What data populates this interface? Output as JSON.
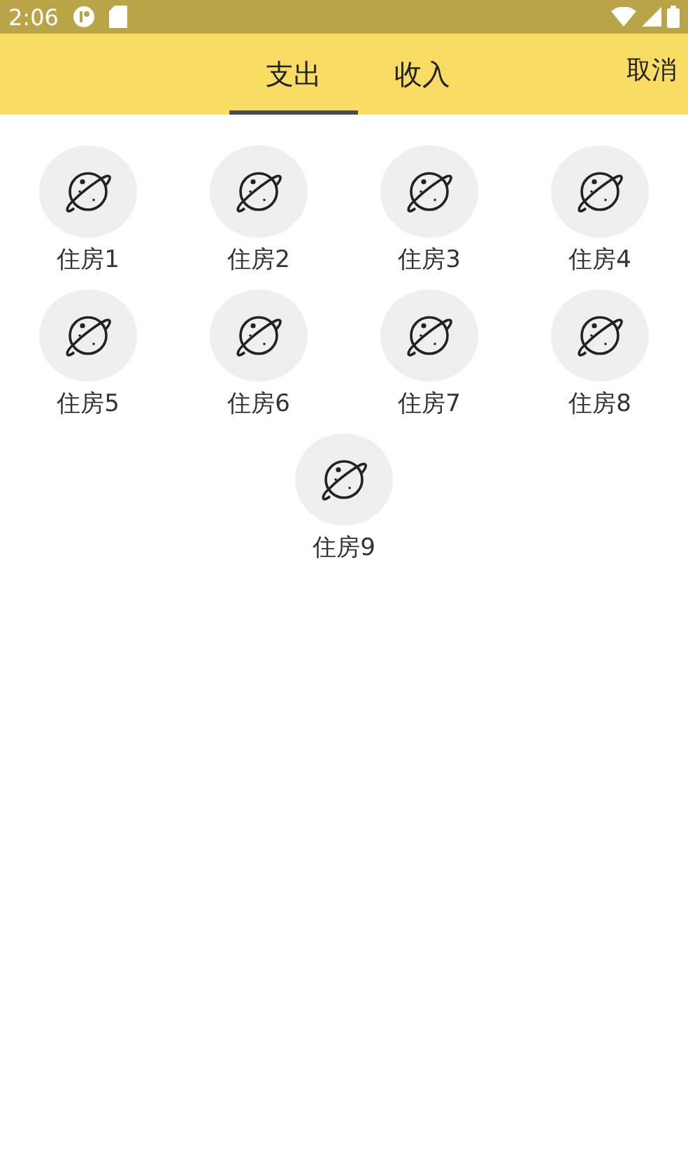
{
  "status_bar": {
    "time": "2:06"
  },
  "tabs": [
    {
      "label": "支出",
      "selected": true
    },
    {
      "label": "收入",
      "selected": false
    }
  ],
  "cancel_button": "取消",
  "categories": [
    {
      "label": "住房1"
    },
    {
      "label": "住房2"
    },
    {
      "label": "住房3"
    },
    {
      "label": "住房4"
    },
    {
      "label": "住房5"
    },
    {
      "label": "住房6"
    },
    {
      "label": "住房7"
    },
    {
      "label": "住房8"
    },
    {
      "label": "住房9"
    }
  ]
}
